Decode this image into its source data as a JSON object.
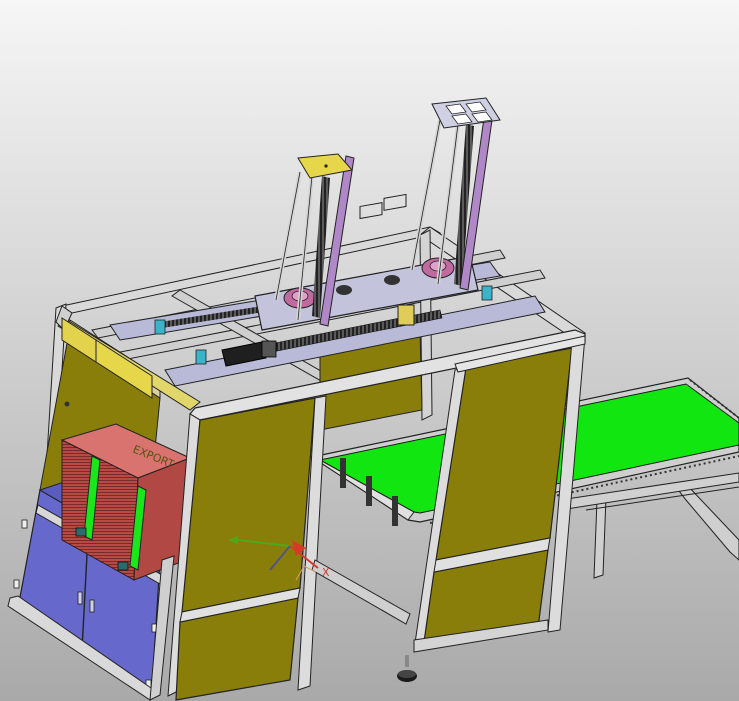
{
  "viewport": {
    "background_top": "#f6f6f6",
    "background_bottom": "#a9a9a9"
  },
  "colors": {
    "frame_profile": "#d8d8d8",
    "frame_edge": "#2a2a2a",
    "olive_panel": "#8a7e0a",
    "olive_panel_light": "#9a8e12",
    "blue_cabinet": "#6668cc",
    "blue_cabinet_dark": "#5052b4",
    "conveyor_belt": "#11e611",
    "stack_pink": "#d9736f",
    "carriage_plate": "#b9bad8",
    "purple_rail": "#b088c8",
    "yellow_plate": "#e6d64a",
    "cable": "#2a2a2a"
  },
  "model": {
    "components": [
      "aluminum-profile-frame",
      "olive-side-panels",
      "blue-storage-cabinet",
      "pink-sheet-stack",
      "green-conveyor",
      "ball-screw-gantry",
      "left-vertical-lift",
      "right-vertical-lift",
      "leveling-foot"
    ]
  },
  "triad": {
    "x_label": "X",
    "axis_colors": [
      "#d83a2a",
      "#27c427",
      "#2a3ad8"
    ]
  }
}
